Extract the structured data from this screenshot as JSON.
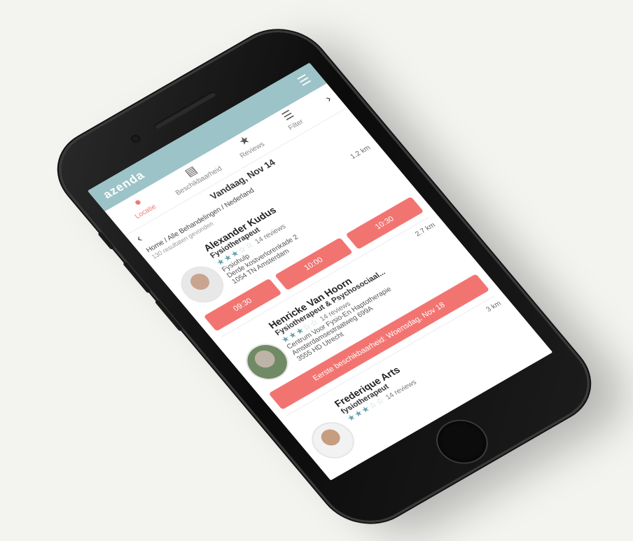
{
  "app": {
    "brand": "azenda",
    "menu_icon": "hamburger-icon"
  },
  "tabs": [
    {
      "label": "Locatie",
      "icon": "location-pin-icon",
      "active": true
    },
    {
      "label": "Beschikbaarheid",
      "icon": "calendar-icon",
      "active": false
    },
    {
      "label": "Reviews",
      "icon": "star-icon",
      "active": false
    },
    {
      "label": "Filter",
      "icon": "sliders-icon",
      "active": false
    }
  ],
  "date_bar": {
    "label": "Vandaag, Nov 14"
  },
  "breadcrumb": {
    "path": "Home / Alle Behandelingen / Nederland",
    "count": "130 resultaten gevonden"
  },
  "practitioners": [
    {
      "name": "Alexander Kudus",
      "title": "Fysiotherapeut",
      "rating": 3,
      "reviews": "14 reviews",
      "practice": "Fysiohulp",
      "street": "Derde kostverlorenkade 2",
      "city": "1054 TN Amsterdam",
      "distance": "1.2 km",
      "slots": [
        "09:30",
        "10:00",
        "10:30"
      ]
    },
    {
      "name": "Henricke Van Hoorn",
      "title": "Fysiotherapeut & Psychosociaal...",
      "rating": 3,
      "reviews": "14 reviews",
      "practice": "Centrum Voor Fysio-En Haptotherapie",
      "street": "Amsterdamsestraatweg 699A",
      "city": "3555 HD Utrecht",
      "distance": "2.7 km",
      "first_available": "Eerste beschikbaarheid: Woensdag, Nov 18"
    },
    {
      "name": "Frederique Arts",
      "title": "fysiotherapeut",
      "rating": 3,
      "reviews": "14 reviews",
      "distance": "3 km"
    }
  ],
  "colors": {
    "accent": "#f27471",
    "header": "#9cc3c7",
    "star": "#6aa3ab"
  }
}
